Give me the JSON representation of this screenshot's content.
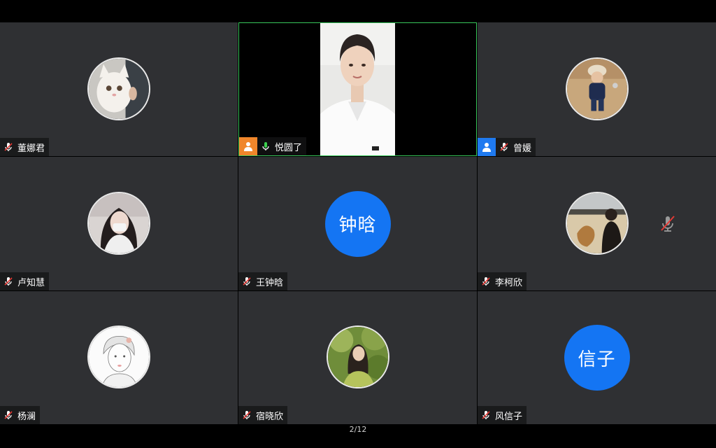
{
  "participants": [
    {
      "name": "董娜君",
      "mic": "muted"
    },
    {
      "name": "悦圆了",
      "mic": "active",
      "host_role": "host",
      "video": true
    },
    {
      "name": "曾媛",
      "mic": "muted",
      "host_role": "co-host"
    },
    {
      "name": "卢知慧",
      "mic": "muted"
    },
    {
      "name": "王钟晗",
      "mic": "muted",
      "initials": "钟晗"
    },
    {
      "name": "李柯欣",
      "mic": "muted",
      "big_mic": "muted"
    },
    {
      "name": "杨澜",
      "mic": "muted"
    },
    {
      "name": "宿晓欣",
      "mic": "muted"
    },
    {
      "name": "风信子",
      "mic": "muted",
      "initials": "信子"
    }
  ],
  "page_indicator": "2/12",
  "colors": {
    "tile_bg": "#2f3033",
    "active_speaker_border": "#38c55a",
    "avatar_blue": "#1475f3",
    "host_badge": "#f0862b",
    "cohost_badge": "#1f7af0",
    "mic_muted": "#e53935",
    "mic_active": "#3ccf4e"
  }
}
